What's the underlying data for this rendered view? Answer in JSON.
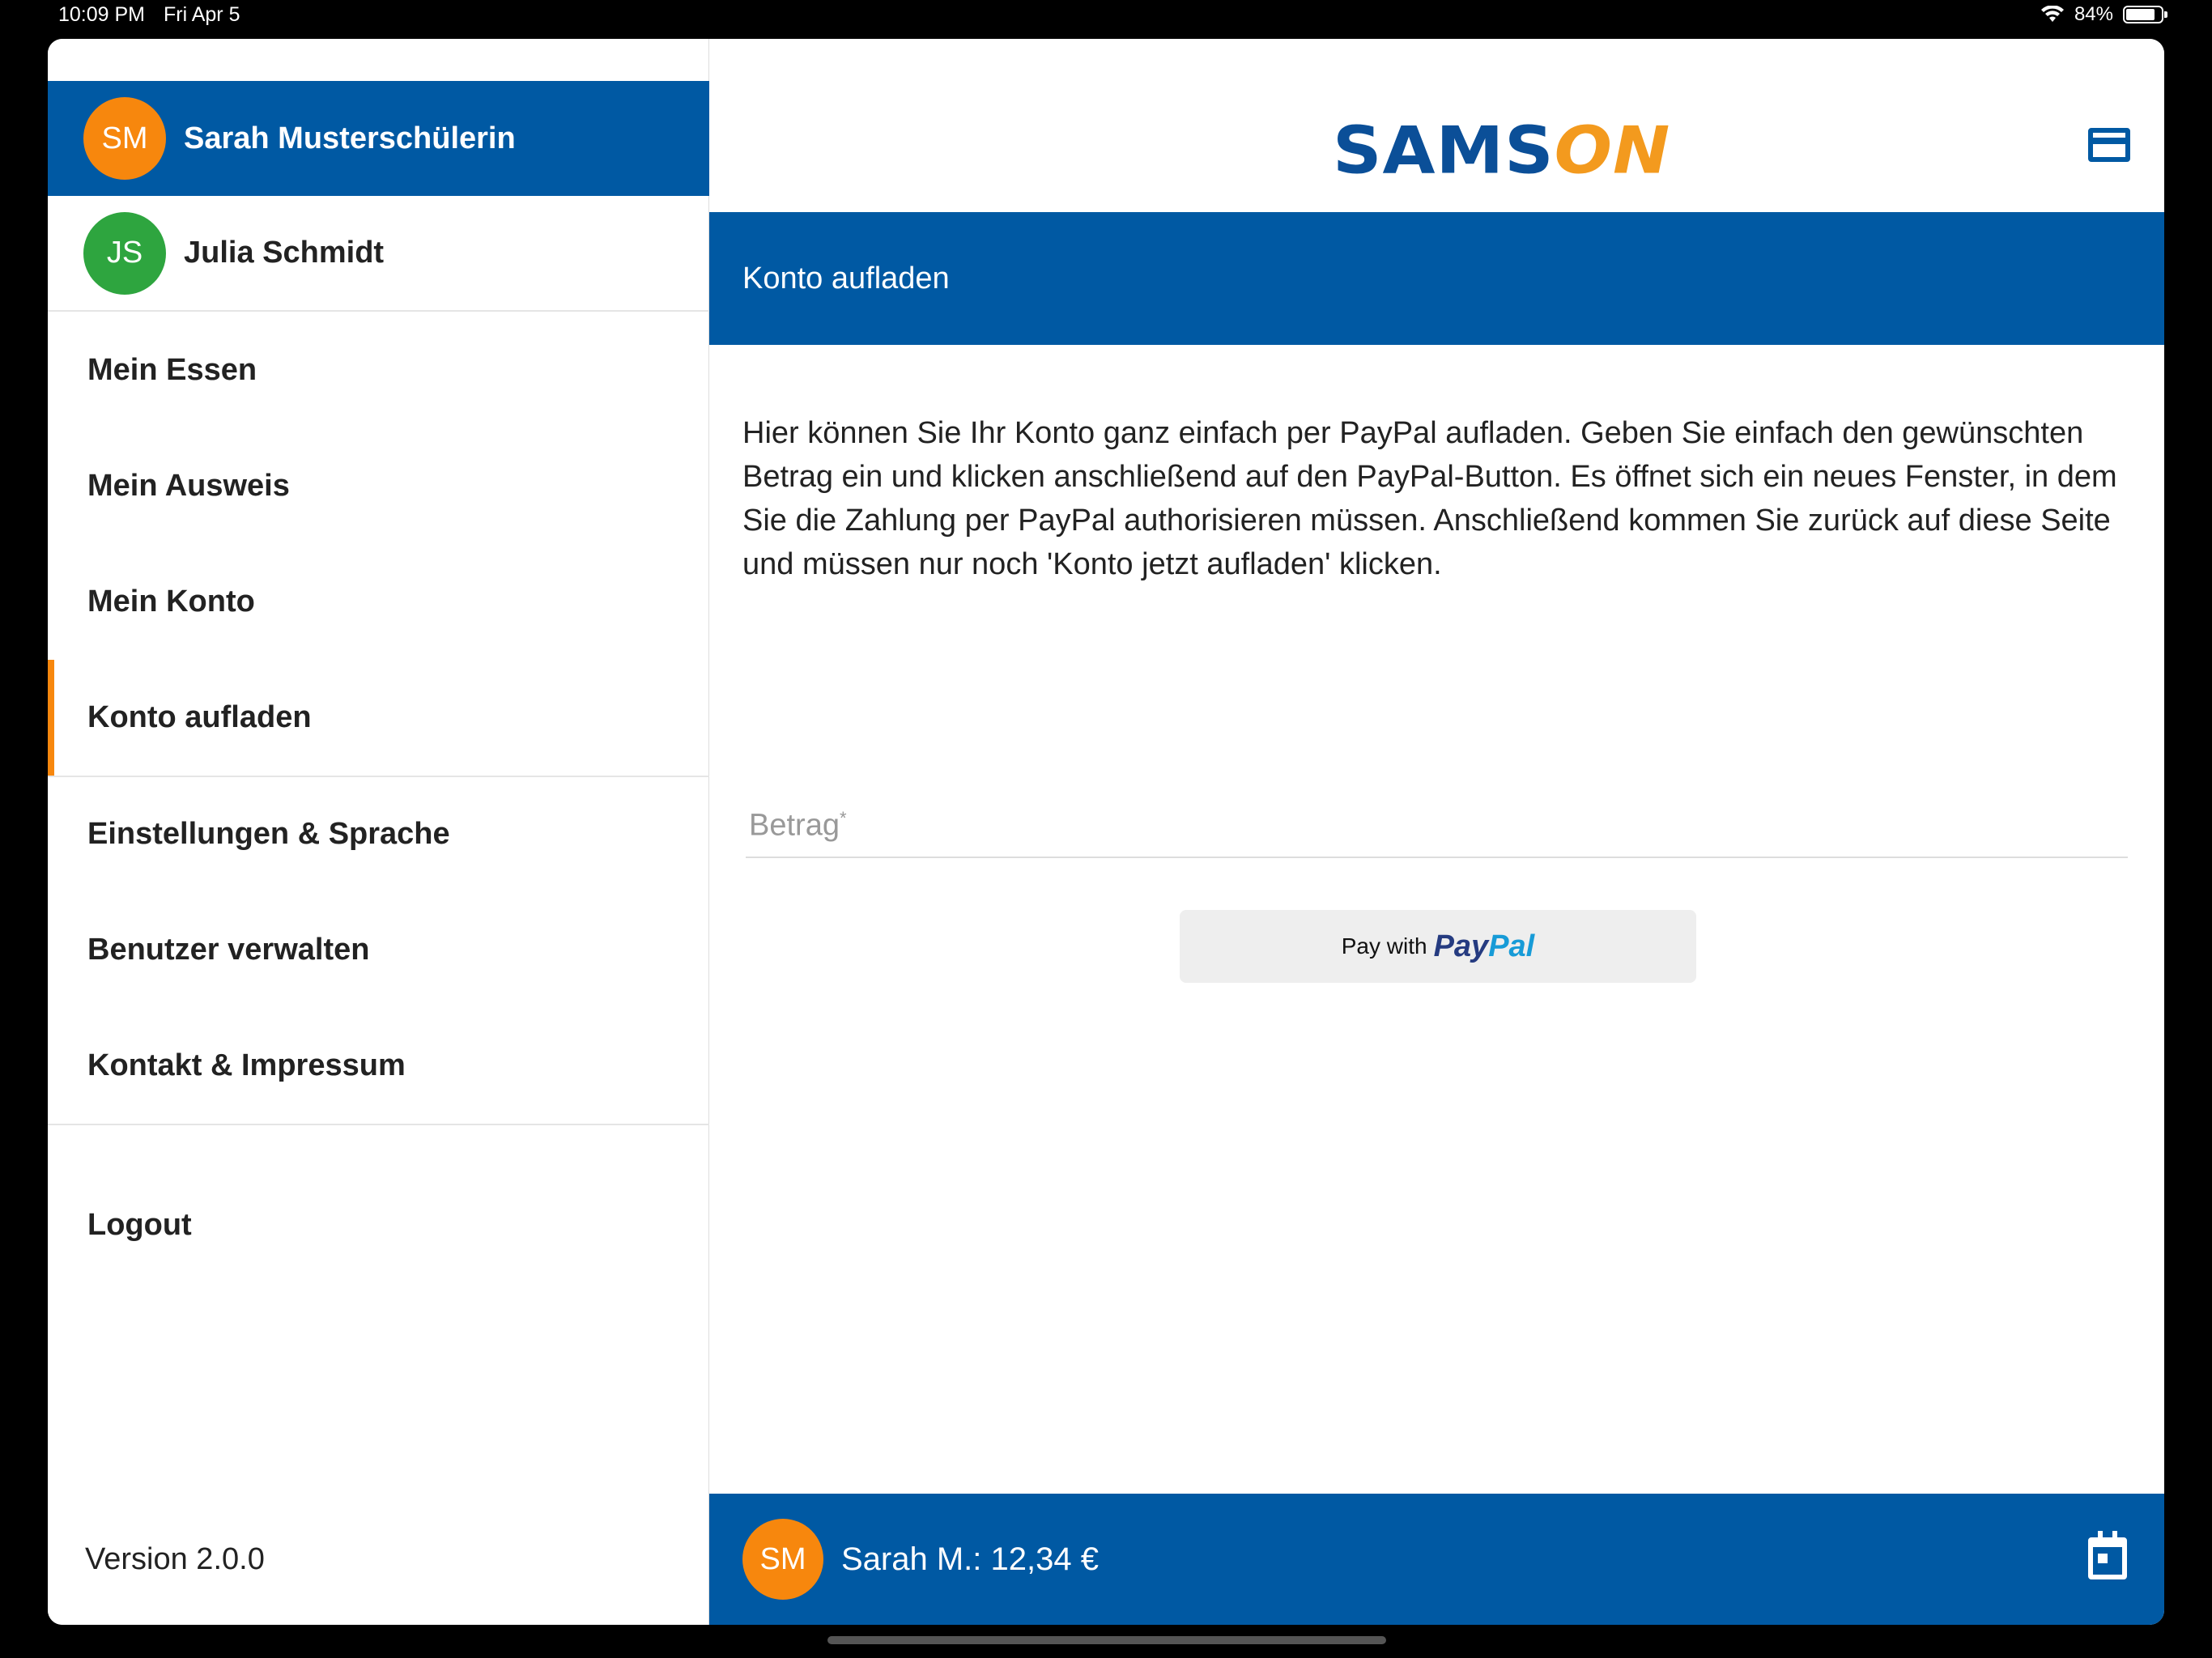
{
  "status_bar": {
    "time": "10:09 PM",
    "date": "Fri Apr 5",
    "battery": "84%",
    "battery_level": 0.84
  },
  "sidebar": {
    "active_user": {
      "initials": "SM",
      "name": "Sarah Musterschülerin",
      "color": "#f7870d"
    },
    "other_user": {
      "initials": "JS",
      "name": "Julia Schmidt",
      "color": "#2ea53f"
    },
    "menu": [
      {
        "label": "Mein Essen"
      },
      {
        "label": "Mein Ausweis"
      },
      {
        "label": "Mein Konto"
      },
      {
        "label": "Konto aufladen",
        "active": true
      },
      {
        "label": "Einstellungen & Sprache"
      },
      {
        "label": "Benutzer verwalten"
      },
      {
        "label": "Kontakt & Impressum"
      },
      {
        "label": "Logout"
      }
    ],
    "version": "Version 2.0.0"
  },
  "header": {
    "logo_part1": "SAMS",
    "logo_part2": "ON",
    "icon": "credit-card-icon"
  },
  "page": {
    "title": "Konto aufladen",
    "description": "Hier können Sie Ihr Konto ganz einfach per PayPal aufladen. Geben Sie einfach den gewünschten Betrag ein und klicken anschließend auf den PayPal-Button. Es öffnet sich ein neues Fenster, in dem Sie die Zahlung per PayPal authorisieren müssen. Anschließend kommen Sie zurück auf diese Seite und müssen nur noch 'Konto jetzt aufladen' klicken.",
    "amount_label": "Betrag",
    "amount_required": "*",
    "amount_value": "",
    "paypal_prefix": "Pay with",
    "paypal_brand_1": "Pay",
    "paypal_brand_2": "Pal"
  },
  "footer": {
    "initials": "SM",
    "balance_text": "Sarah M.: 12,34 €",
    "icon": "calendar-icon"
  },
  "colors": {
    "primary": "#0059a3",
    "accent": "#f7870d"
  }
}
